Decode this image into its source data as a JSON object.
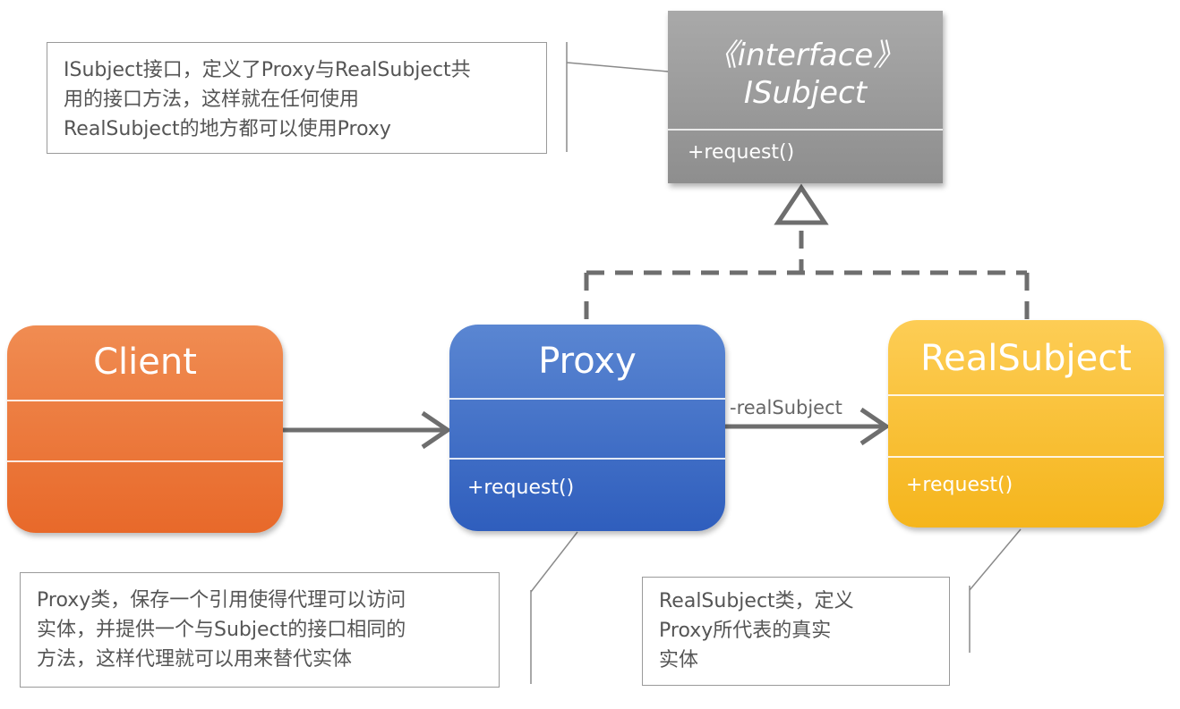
{
  "interface": {
    "stereotype": "《interface》",
    "name": "ISubject",
    "operation": "+request()",
    "color": "#9c9c9c"
  },
  "classes": {
    "client": {
      "name": "Client",
      "color": "#ee7635"
    },
    "proxy": {
      "name": "Proxy",
      "operation": "+request()",
      "color": "#3f6fc6"
    },
    "real_subject": {
      "name": "RealSubject",
      "operation": "+request()",
      "color": "#f9bf2f"
    }
  },
  "associations": {
    "proxy_to_real_label": "-realSubject"
  },
  "notes": {
    "isubject": [
      "ISubject接口，定义了Proxy与RealSubject共",
      "用的接口方法，这样就在任何使用",
      "RealSubject的地方都可以使用Proxy"
    ],
    "proxy": [
      "Proxy类，保存一个引用使得代理可以访问",
      "实体，并提供一个与Subject的接口相同的",
      "方法，这样代理就可以用来替代实体"
    ],
    "real_subject": [
      "RealSubject类，定义",
      "Proxy所代表的真实",
      "实体"
    ]
  }
}
